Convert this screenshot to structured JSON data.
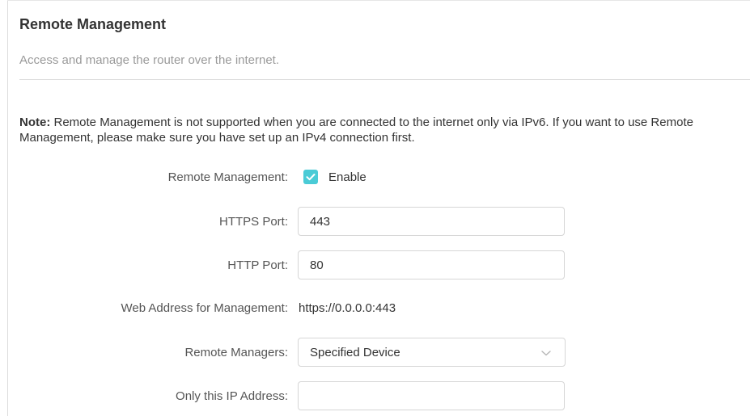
{
  "section": {
    "title": "Remote Management",
    "description": "Access and manage the router over the internet."
  },
  "note": {
    "label": "Note:",
    "text": "Remote Management is not supported when you are connected to the internet only via IPv6. If you want to use Remote Management, please make sure you have set up an IPv4 connection first."
  },
  "form": {
    "remote_management": {
      "label": "Remote Management:",
      "checkbox_label": "Enable",
      "checked": true
    },
    "https_port": {
      "label": "HTTPS Port:",
      "value": "443"
    },
    "http_port": {
      "label": "HTTP Port:",
      "value": "80"
    },
    "web_address": {
      "label": "Web Address for Management:",
      "value": "https://0.0.0.0:443"
    },
    "remote_managers": {
      "label": "Remote Managers:",
      "selected": "Specified Device"
    },
    "ip_address": {
      "label": "Only this IP Address:",
      "value": ""
    }
  },
  "colors": {
    "accent": "#4acbd6",
    "border": "#d6d6d6",
    "muted_text": "#9a9a9a"
  },
  "icons": {
    "checkbox": "check-icon",
    "select": "chevron-down-icon"
  }
}
